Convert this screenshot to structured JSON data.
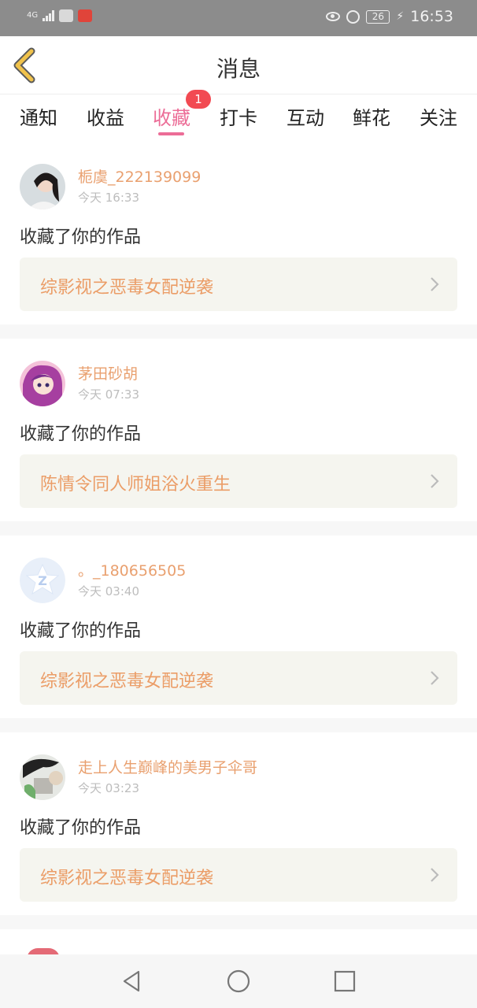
{
  "status_bar": {
    "signal_label": "4G",
    "time": "16:53",
    "battery": "26"
  },
  "header": {
    "title": "消息"
  },
  "tabs": [
    {
      "label": "通知"
    },
    {
      "label": "收益"
    },
    {
      "label": "收藏",
      "active": true,
      "badge": "1"
    },
    {
      "label": "打卡"
    },
    {
      "label": "互动"
    },
    {
      "label": "鲜花"
    },
    {
      "label": "关注"
    }
  ],
  "items": [
    {
      "username": "栀虞_222139099",
      "time": "今天 16:33",
      "action": "收藏了你的作品",
      "work": "综影视之恶毒女配逆袭",
      "avatar_icon": "user-photo-avatar"
    },
    {
      "username": "茅田砂胡",
      "time": "今天 07:33",
      "action": "收藏了你的作品",
      "work": "陈情令同人师姐浴火重生",
      "avatar_icon": "anime-avatar"
    },
    {
      "username": "。_180656505",
      "time": "今天 03:40",
      "action": "收藏了你的作品",
      "work": "综影视之恶毒女配逆袭",
      "avatar_icon": "default-star-avatar"
    },
    {
      "username": "走上人生巅峰的美男子伞哥",
      "time": "今天 03:23",
      "action": "收藏了你的作品",
      "work": "综影视之恶毒女配逆袭",
      "avatar_icon": "user-photo-avatar"
    }
  ],
  "colors": {
    "accent": "#ec6d97",
    "username": "#e9a06f",
    "work_title": "#eb9d67",
    "badge": "#f24a52",
    "back_arrow": "#f0c24b"
  }
}
